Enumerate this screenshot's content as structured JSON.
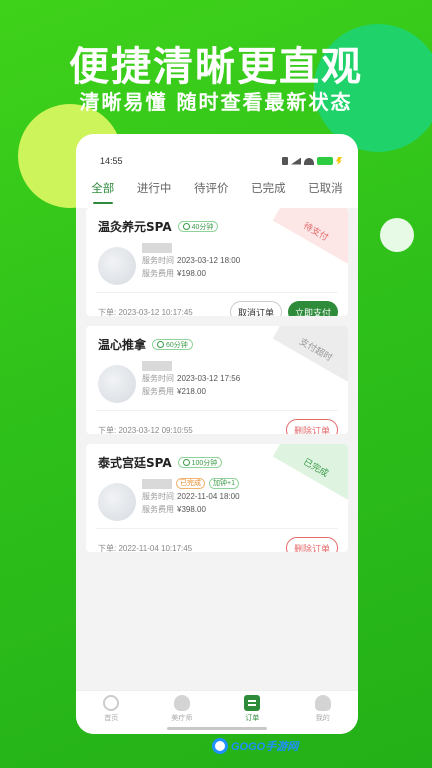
{
  "promo": {
    "headline": "便捷清晰更直观",
    "subline": "清晰易懂 随时查看最新状态"
  },
  "status_bar": {
    "time": "14:55"
  },
  "tabs": [
    "全部",
    "进行中",
    "待评价",
    "已完成",
    "已取消"
  ],
  "orders": [
    {
      "title": "温灸养元SPA",
      "duration": "40分钟",
      "status": "待支付",
      "tags": [],
      "time_label": "服务时间",
      "time_value": "2023-03-12 18:00",
      "fee_label": "服务费用",
      "fee_value": "¥198.00",
      "order_time": "下单: 2023-03-12 10:17:45",
      "buttons": [
        "取消订单",
        "立即支付"
      ]
    },
    {
      "title": "温心推拿",
      "duration": "60分钟",
      "status": "支付超时",
      "tags": [],
      "time_label": "服务时间",
      "time_value": "2023-03-12 17:56",
      "fee_label": "服务费用",
      "fee_value": "¥218.00",
      "order_time": "下单: 2023-03-12 09:10:55",
      "buttons": [
        "删除订单"
      ]
    },
    {
      "title": "泰式宫廷SPA",
      "duration": "100分钟",
      "status": "已完成",
      "tags": [
        "已完成",
        "加钟+1"
      ],
      "time_label": "服务时间",
      "time_value": "2022-11-04 18:00",
      "fee_label": "服务费用",
      "fee_value": "¥398.00",
      "order_time": "下单: 2022-11-04 10:17:45",
      "buttons": [
        "删除订单"
      ]
    }
  ],
  "bottom_nav": [
    "首页",
    "美疗师",
    "订单",
    "我的"
  ],
  "watermark": "GOGO手游网",
  "colors": {
    "brand_green": "#2e8b3a",
    "background": "#2fc11a",
    "alert_red": "#e36a6a"
  }
}
